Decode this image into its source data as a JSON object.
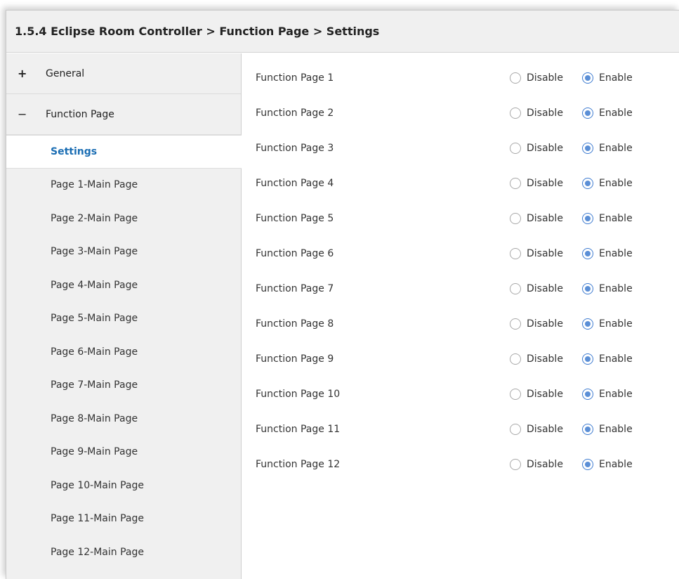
{
  "title": "1.5.4 Eclipse Room Controller > Function Page > Settings",
  "sidebar": {
    "groups": [
      {
        "sign": "+",
        "label": "General"
      },
      {
        "sign": "−",
        "label": "Function Page"
      }
    ],
    "items": [
      "Settings",
      "Page 1-Main Page",
      "Page 2-Main Page",
      "Page 3-Main Page",
      "Page 4-Main Page",
      "Page 5-Main Page",
      "Page 6-Main Page",
      "Page 7-Main Page",
      "Page 8-Main Page",
      "Page 9-Main Page",
      "Page 10-Main Page",
      "Page 11-Main Page",
      "Page 12-Main Page"
    ],
    "selected_item": "Settings"
  },
  "options": {
    "disable_label": "Disable",
    "enable_label": "Enable"
  },
  "settings": [
    {
      "label": "Function Page 1",
      "value": "Enable"
    },
    {
      "label": "Function Page 2",
      "value": "Enable"
    },
    {
      "label": "Function Page 3",
      "value": "Enable"
    },
    {
      "label": "Function Page 4",
      "value": "Enable"
    },
    {
      "label": "Function Page 5",
      "value": "Enable"
    },
    {
      "label": "Function Page 6",
      "value": "Enable"
    },
    {
      "label": "Function Page 7",
      "value": "Enable"
    },
    {
      "label": "Function Page 8",
      "value": "Enable"
    },
    {
      "label": "Function Page 9",
      "value": "Enable"
    },
    {
      "label": "Function Page 10",
      "value": "Enable"
    },
    {
      "label": "Function Page 11",
      "value": "Enable"
    },
    {
      "label": "Function Page 12",
      "value": "Enable"
    }
  ]
}
